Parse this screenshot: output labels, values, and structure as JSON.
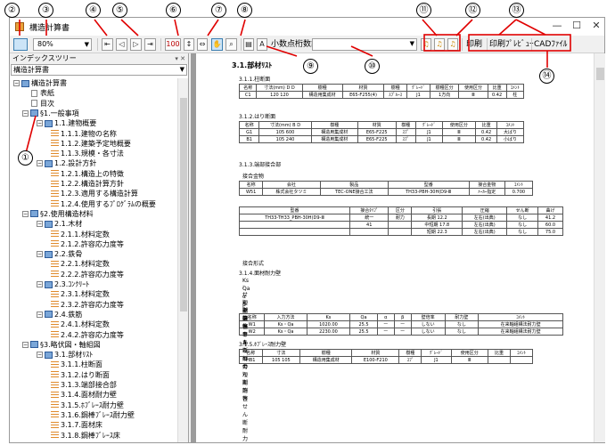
{
  "window": {
    "title": "構造計算書",
    "controls": {
      "minimize": "—",
      "maximize": "☐",
      "close": "✕"
    }
  },
  "toolbar": {
    "zoom_value": "80%",
    "search_value": "",
    "decimal_button": "小数点桁数設定",
    "print_button": "印刷",
    "print_preview_button": "印刷ﾌﾟﾚﾋﾞｭｰ",
    "cad_button": "CADﾌｧｲﾙ",
    "fit_width": "100",
    "arrow": "⇔"
  },
  "left_panel": {
    "title": "インデックスツリー",
    "pin": "▾ ✕",
    "selected": "構造計算書",
    "tree": [
      {
        "label": "構造計算書",
        "kind": "book",
        "level": 0
      },
      {
        "label": "表紙",
        "kind": "page",
        "level": 1
      },
      {
        "label": "目次",
        "kind": "page",
        "level": 1
      },
      {
        "label": "§1.一般事項",
        "kind": "book",
        "level": 1
      },
      {
        "label": "1.1.建物概要",
        "kind": "book",
        "level": 2
      },
      {
        "label": "1.1.1.建物の名称",
        "kind": "leaf",
        "level": 3
      },
      {
        "label": "1.1.2.建築予定地概要",
        "kind": "leaf",
        "level": 3
      },
      {
        "label": "1.1.3.規模・各寸法",
        "kind": "leaf",
        "level": 3
      },
      {
        "label": "1.2.設計方針",
        "kind": "book",
        "level": 2
      },
      {
        "label": "1.2.1.構造上の特徴",
        "kind": "leaf",
        "level": 3
      },
      {
        "label": "1.2.2.構造計算方針",
        "kind": "leaf",
        "level": 3
      },
      {
        "label": "1.2.3.適用する構造計算",
        "kind": "leaf",
        "level": 3
      },
      {
        "label": "1.2.4.使用するﾌﾟﾛｸﾞﾗﾑの概要",
        "kind": "leaf",
        "level": 3
      },
      {
        "label": "§2.使用構造材料",
        "kind": "book",
        "level": 1
      },
      {
        "label": "2.1.木材",
        "kind": "book",
        "level": 2
      },
      {
        "label": "2.1.1.材料定数",
        "kind": "leaf",
        "level": 3
      },
      {
        "label": "2.1.2.許容応力度等",
        "kind": "leaf",
        "level": 3
      },
      {
        "label": "2.2.鉄骨",
        "kind": "book",
        "level": 2
      },
      {
        "label": "2.2.1.材料定数",
        "kind": "leaf",
        "level": 3
      },
      {
        "label": "2.2.2.許容応力度等",
        "kind": "leaf",
        "level": 3
      },
      {
        "label": "2.3.ｺﾝｸﾘｰﾄ",
        "kind": "book",
        "level": 2
      },
      {
        "label": "2.3.1.材料定数",
        "kind": "leaf",
        "level": 3
      },
      {
        "label": "2.3.2.許容応力度等",
        "kind": "leaf",
        "level": 3
      },
      {
        "label": "2.4.鉄筋",
        "kind": "book",
        "level": 2
      },
      {
        "label": "2.4.1.材料定数",
        "kind": "leaf",
        "level": 3
      },
      {
        "label": "2.4.2.許容応力度等",
        "kind": "leaf",
        "level": 3
      },
      {
        "label": "§3.略伏図・軸組図",
        "kind": "book",
        "level": 1
      },
      {
        "label": "3.1.部材ﾘｽﾄ",
        "kind": "book",
        "level": 2
      },
      {
        "label": "3.1.1.柱断面",
        "kind": "leaf",
        "level": 3
      },
      {
        "label": "3.1.2.はり断面",
        "kind": "leaf",
        "level": 3
      },
      {
        "label": "3.1.3.端部接合部",
        "kind": "leaf",
        "level": 3
      },
      {
        "label": "3.1.4.面材耐力壁",
        "kind": "leaf",
        "level": 3
      },
      {
        "label": "3.1.5.ﾎﾌﾞﾚｰｽ耐力壁",
        "kind": "leaf",
        "level": 3
      },
      {
        "label": "3.1.6.鋼棒ﾌﾞﾚｰｽ耐力壁",
        "kind": "leaf",
        "level": 3
      },
      {
        "label": "3.1.7.面材床",
        "kind": "leaf",
        "level": 3
      },
      {
        "label": "3.1.8.鋼棒ﾌﾞﾚｰｽ床",
        "kind": "leaf",
        "level": 3
      }
    ]
  },
  "document": {
    "heading": "3.1.部材ﾘｽﾄ",
    "s1": "3.1.1.柱断面",
    "t1": {
      "head": [
        "名称",
        "寸法(mm) D D",
        "樹種",
        "材質",
        "樹種",
        "ｸﾞﾚｰﾄﾞ",
        "樹種区分",
        "使用区分",
        "比重",
        "ｺﾒﾝﾄ"
      ],
      "rows": [
        [
          "C1",
          "120 120",
          "構造用集成材",
          "E65-F255(4)",
          "ｽﾌﾟﾙｰｽ",
          "J1",
          "1方向",
          "Ⅲ",
          "0.42",
          "柱"
        ]
      ]
    },
    "s2": "3.1.2.はり断面",
    "t2": {
      "head": [
        "名称",
        "寸法(mm) B D",
        "樹種",
        "材質",
        "樹種",
        "ｸﾞﾚｰﾄﾞ",
        "使用区分",
        "比重",
        "ｺﾒﾝﾄ"
      ],
      "rows": [
        [
          "G1",
          "105 600",
          "構造用集成材",
          "E65-F225",
          "ｽﾌﾟ",
          "J1",
          "Ⅲ",
          "0.42",
          "大ばり"
        ],
        [
          "B1",
          "105 240",
          "構造用集成材",
          "E65-F225",
          "ｽﾌﾟ",
          "J1",
          "Ⅲ",
          "0.42",
          "小ばり"
        ]
      ]
    },
    "s3": "3.1.3.端部接合部",
    "sub3a": "接合金物",
    "t3": {
      "head": [
        "名称",
        "会社",
        "製品",
        "型番",
        "接合金物",
        "ｺﾒﾝﾄ"
      ],
      "rows": [
        [
          "W51",
          "株式会社タツミ",
          "TEC-ONE接合工法",
          "TH33-PBH-30H(D9-Ⅲ",
          "ﾒｰｶｰ指定",
          "0.700"
        ]
      ]
    },
    "t4": {
      "head": [
        "型番",
        "接合ﾀｲﾌﾟ",
        "区分",
        "引張",
        "圧縮",
        "せん断",
        "曲げ"
      ],
      "rows": [
        [
          "TH33-TH33_PBH-30H(D9-Ⅲ",
          "統一",
          "耐力",
          "長期 12.2",
          "左右(出典)",
          "なし",
          "41.2"
        ],
        [
          "",
          "41",
          "",
          "中短期 17.8",
          "左右(出典)",
          "なし",
          "60.0"
        ],
        [
          "",
          "",
          "",
          "短期 22.3",
          "左右(出典)",
          "なし",
          "75.0"
        ]
      ]
    },
    "sub3b": "接合形式",
    "s4": "3.1.4.面材耐力壁",
    "notes": [
      "Ks : せん断剛性",
      "Qa : 短期許容せん断耐力",
      "α : 壁倍率あたりのせん断剛性",
      "β : 壁倍率あたりの短期許容せん断耐力"
    ],
    "t5": {
      "head": [
        "名称",
        "入力方法",
        "Ks",
        "Qa",
        "α",
        "β",
        "壁倍率",
        "耐力壁",
        "ｺﾒﾝﾄ"
      ],
      "rows": [
        [
          "W1",
          "Ks・Qa",
          "1020.00",
          "25.5",
          "ー",
          "ー",
          "しない",
          "なし",
          "在来軸組構法耐力壁"
        ],
        [
          "W2",
          "Ks・Qa",
          "2230.00",
          "25.5",
          "ー",
          "ー",
          "しない",
          "なし",
          "在来軸組構法耐力壁"
        ]
      ]
    },
    "s5": "3.1.5.ﾎﾌﾞﾚｰｽ耐力壁",
    "t6": {
      "head": [
        "名称",
        "寸法",
        "樹種",
        "材質",
        "樹種",
        "ｸﾞﾚｰﾄﾞ",
        "使用区分",
        "比重",
        "ｺﾒﾝﾄ"
      ],
      "rows": [
        [
          "HB1",
          "105 105",
          "構造用集成材",
          "E100-F210",
          "ｽﾌﾟ",
          "J1",
          "Ⅲ",
          "",
          ""
        ]
      ]
    }
  },
  "callouts": [
    "①",
    "②",
    "③",
    "④",
    "⑤",
    "⑥",
    "⑦",
    "⑧",
    "⑨",
    "⑩",
    "⑪",
    "⑫",
    "⑬",
    "⑭"
  ]
}
